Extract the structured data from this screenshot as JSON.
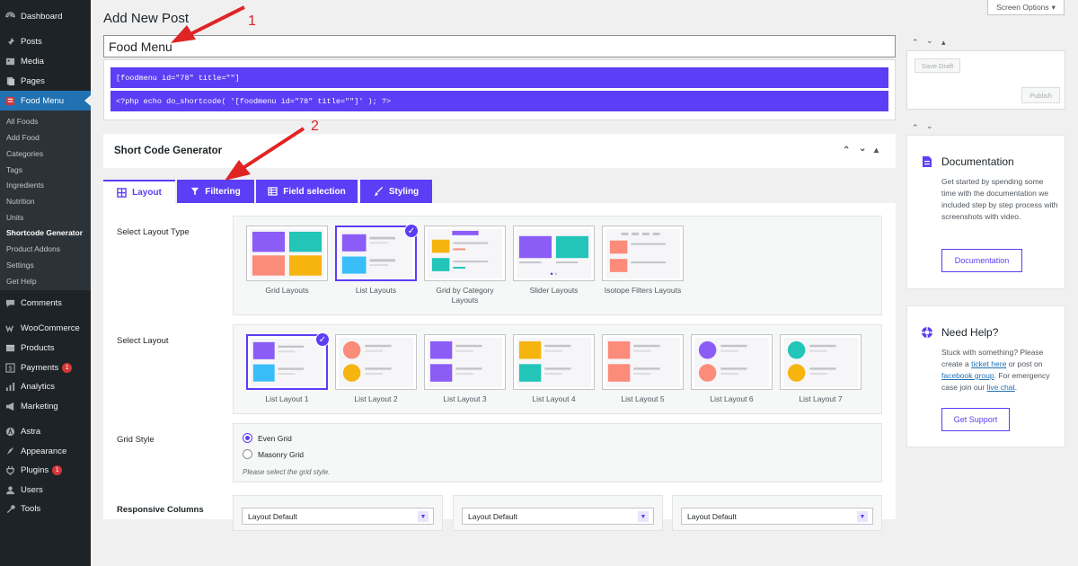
{
  "sidebar": {
    "menu": [
      {
        "label": "Dashboard",
        "icon": "dashboard-icon"
      },
      {
        "label": "Posts",
        "icon": "pin-icon"
      },
      {
        "label": "Media",
        "icon": "media-icon"
      },
      {
        "label": "Pages",
        "icon": "pages-icon"
      },
      {
        "label": "Food Menu",
        "icon": "food-menu-icon"
      }
    ],
    "submenu": [
      "All Foods",
      "Add Food",
      "Categories",
      "Tags",
      "Ingredients",
      "Nutrition",
      "Units",
      "Shortcode Generator",
      "Product Addons",
      "Settings",
      "Get Help"
    ],
    "menu2": [
      {
        "label": "Comments",
        "icon": "comments-icon"
      },
      {
        "label": "WooCommerce",
        "icon": "woocommerce-icon"
      },
      {
        "label": "Products",
        "icon": "products-icon"
      },
      {
        "label": "Payments",
        "icon": "payments-icon",
        "badge": "1"
      },
      {
        "label": "Analytics",
        "icon": "analytics-icon"
      },
      {
        "label": "Marketing",
        "icon": "marketing-icon"
      },
      {
        "label": "Astra",
        "icon": "astra-icon"
      },
      {
        "label": "Appearance",
        "icon": "appearance-icon"
      },
      {
        "label": "Plugins",
        "icon": "plugins-icon",
        "badge": "1"
      },
      {
        "label": "Users",
        "icon": "users-icon"
      },
      {
        "label": "Tools",
        "icon": "tools-icon"
      }
    ]
  },
  "header": {
    "title": "Add New Post",
    "screen_options": "Screen Options"
  },
  "post": {
    "title_value": "Food Menu"
  },
  "shortcodes": {
    "line1": "[foodmenu id=\"78\" title=\"\"]",
    "line2": "<?php echo do_shortcode( '[foodmenu id=\"78\" title=\"\"]' ); ?>"
  },
  "generator": {
    "title": "Short Code Generator",
    "tabs": [
      "Layout",
      "Filtering",
      "Field selection",
      "Styling"
    ],
    "layout_type_label": "Select Layout Type",
    "layout_types": [
      "Grid Layouts",
      "List Layouts",
      "Grid by Category Layouts",
      "Slider Layouts",
      "Isotope Filters Layouts"
    ],
    "layout_label": "Select Layout",
    "layouts": [
      "List Layout 1",
      "List Layout 2",
      "List Layout 3",
      "List Layout 4",
      "List Layout 5",
      "List Layout 6",
      "List Layout 7"
    ],
    "grid_style_label": "Grid Style",
    "grid_options": [
      "Even Grid",
      "Masonry Grid"
    ],
    "grid_hint": "Please select the grid style.",
    "responsive_label": "Responsive Columns",
    "responsive_selects": [
      "Layout Default",
      "Layout Default",
      "Layout Default"
    ]
  },
  "publish": {
    "save_draft": "Save Draft",
    "publish": "Publish"
  },
  "documentation": {
    "title": "Documentation",
    "text": "Get started by spending some time with the documentation we included step by step process with screenshots with video.",
    "button": "Documentation"
  },
  "help": {
    "title": "Need Help?",
    "text_before": "Stuck with something? Please create a",
    "link1": "ticket here",
    "text_mid": "or post on",
    "link2": "facebook group",
    "text_after": ". For emergency case join our",
    "link3": "live chat",
    "text_end": ".",
    "button": "Get Support"
  },
  "annotations": [
    "1",
    "2"
  ],
  "colors": {
    "accent": "#5b3ef5",
    "sidebar_bg": "#1d2327",
    "sidebar_active": "#d63638",
    "menu_active_bg": "#2271b1",
    "arrow": "#e02424"
  }
}
